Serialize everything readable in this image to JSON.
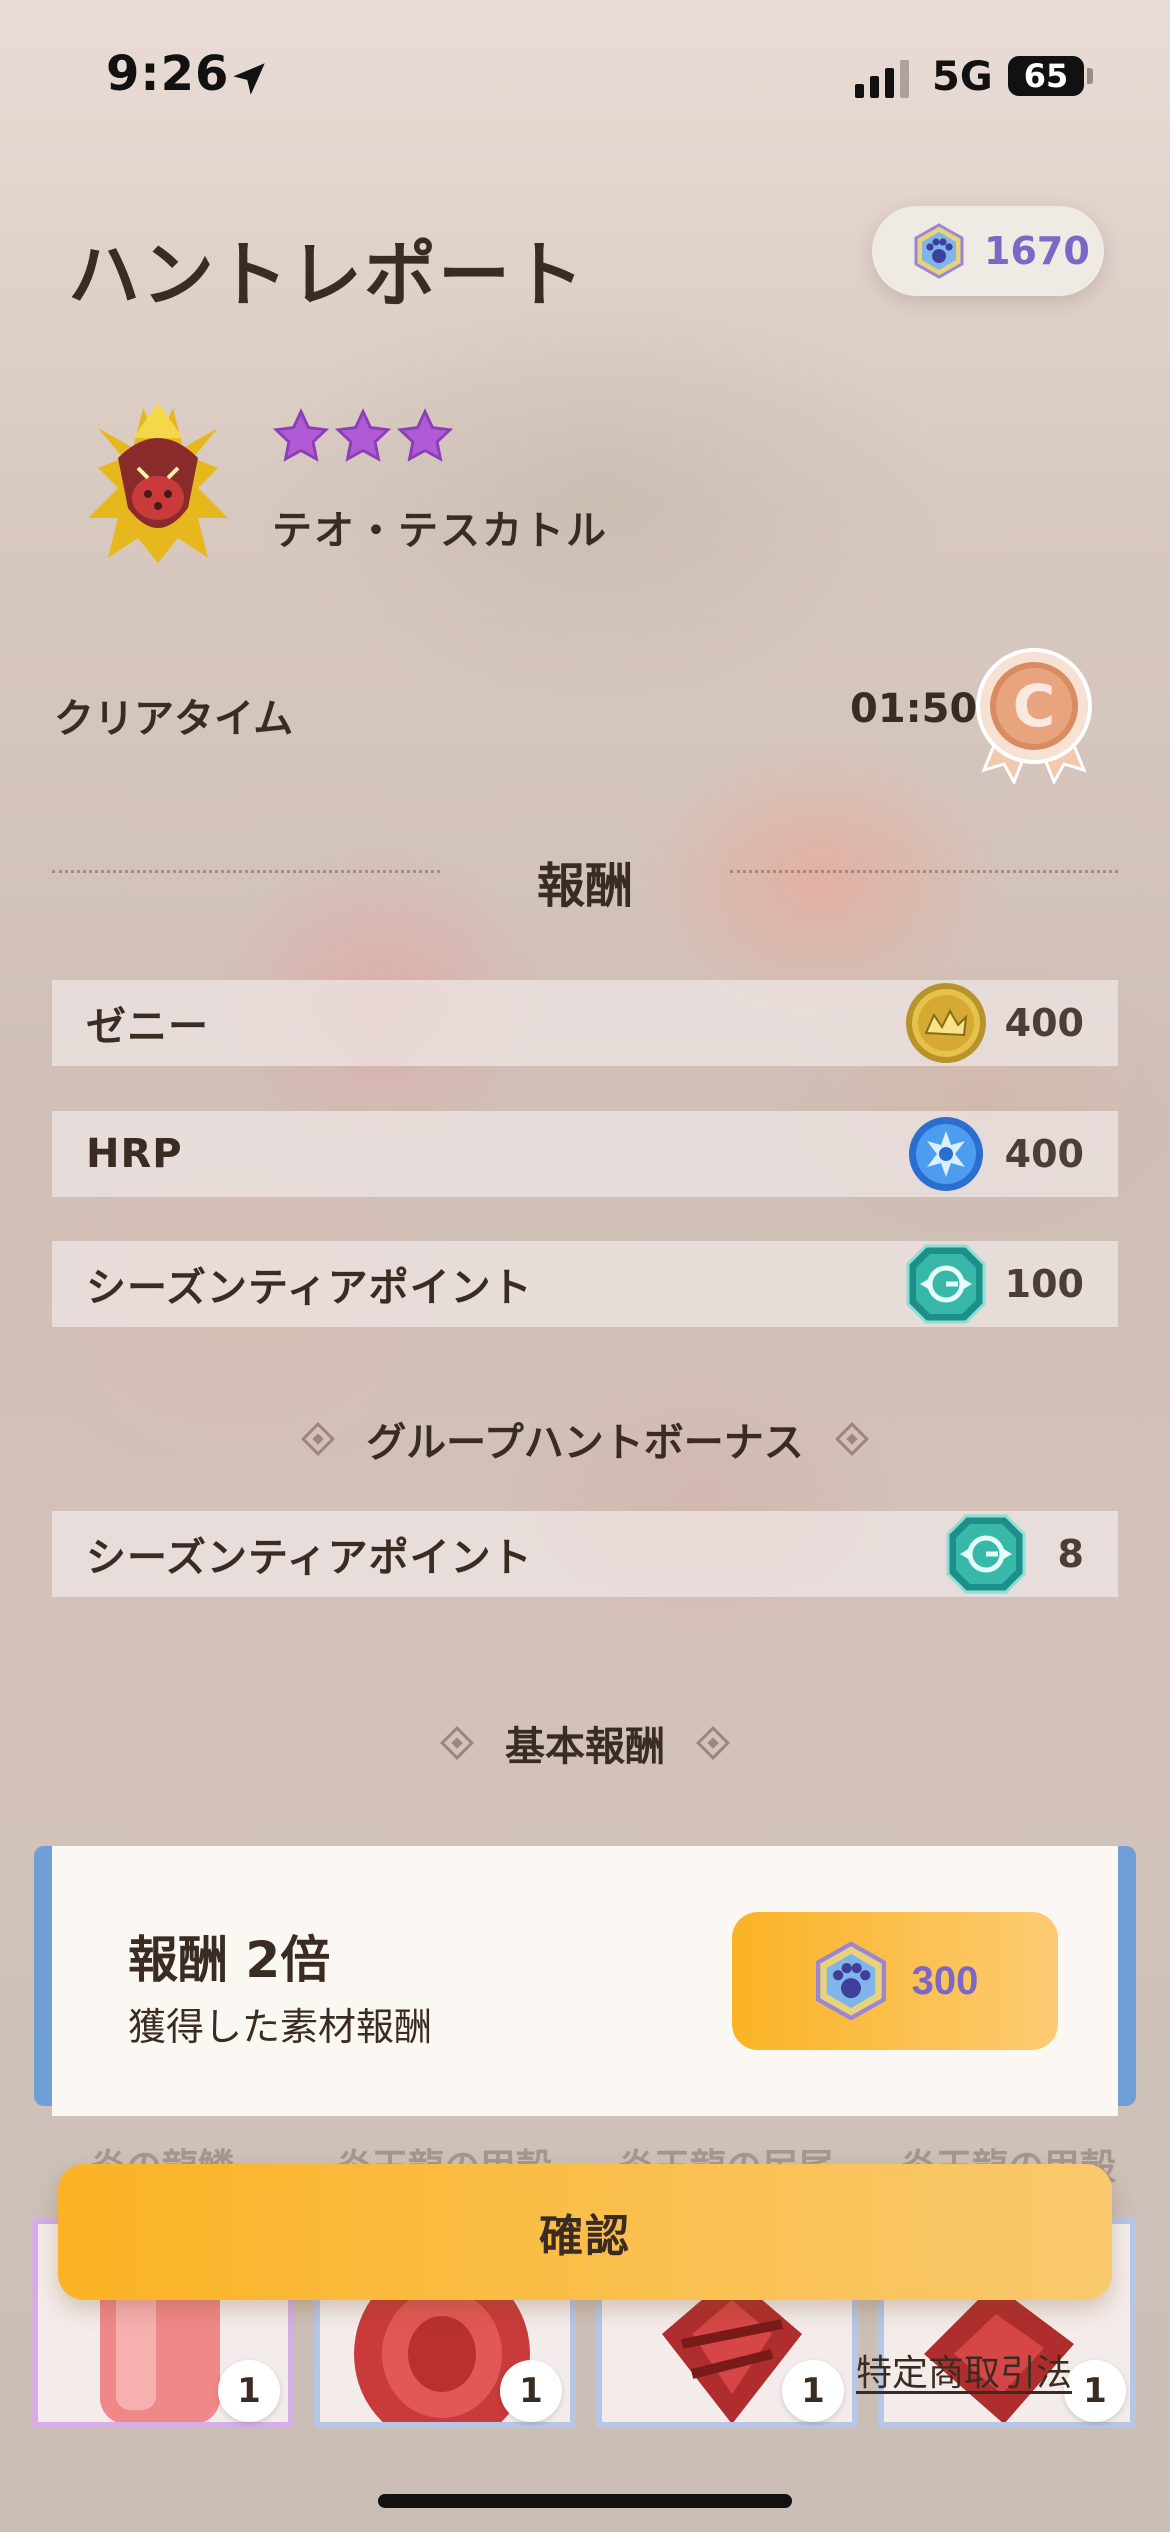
{
  "status_bar": {
    "time": "9:26",
    "network": "5G",
    "battery": "65"
  },
  "header": {
    "title": "ハントレポート",
    "currency_value": "1670"
  },
  "monster": {
    "name": "テオ・テスカトル",
    "stars": 3
  },
  "clear_time": {
    "label": "クリアタイム",
    "value": "01:50",
    "medal_letter": "C"
  },
  "rewards": {
    "title": "報酬",
    "items": [
      {
        "label": "ゼニー",
        "icon": "zenny-coin-icon",
        "amount": "400"
      },
      {
        "label": "HRP",
        "icon": "hrp-icon",
        "amount": "400"
      },
      {
        "label": "シーズンティアポイント",
        "icon": "season-tier-icon",
        "amount": "100"
      }
    ]
  },
  "group_bonus": {
    "title": "グループハントボーナス",
    "items": [
      {
        "label": "シーズンティアポイント",
        "icon": "season-tier-icon",
        "amount": "8"
      }
    ]
  },
  "basic_rewards": {
    "title": "基本報酬"
  },
  "double_offer": {
    "title": "報酬 2倍",
    "subtitle": "獲得した素材報酬",
    "price": "300"
  },
  "materials": [
    {
      "name": "炎の龍鱗",
      "count": "1"
    },
    {
      "name": "炎王龍の甲殻",
      "count": "1"
    },
    {
      "name": "炎王龍の尻尾",
      "count": "1"
    },
    {
      "name": "炎王龍の甲殻",
      "count": "1"
    }
  ],
  "confirm_label": "確認",
  "legal_link": "特定商取引法",
  "colors": {
    "accent_orange": "#fbb325",
    "gem_purple": "#7d67c4",
    "card_blue": "#6f9fd6"
  }
}
